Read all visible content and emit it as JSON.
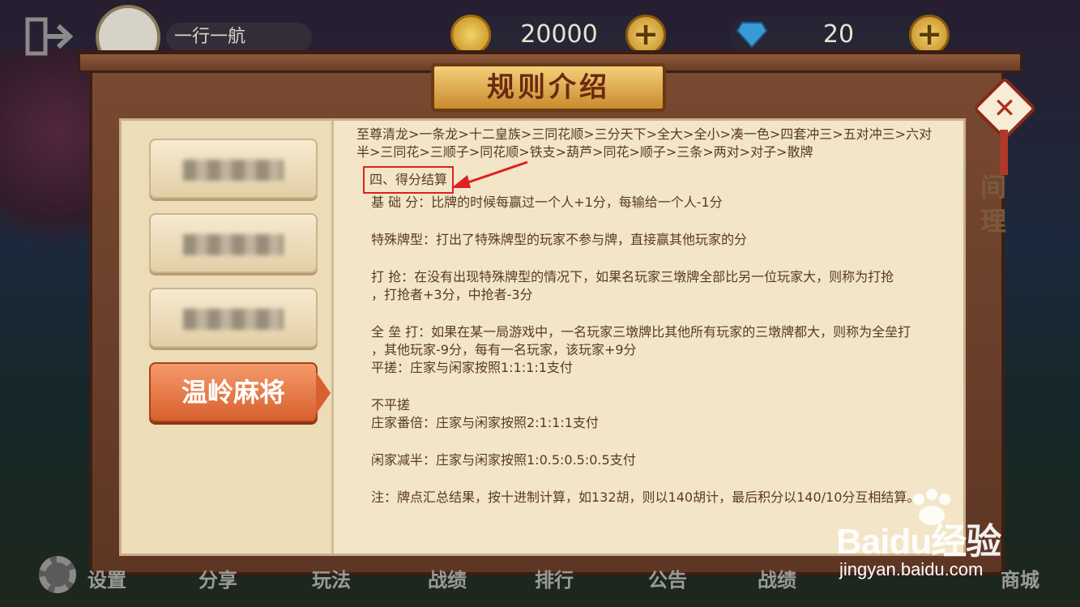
{
  "window": {
    "title": "规则介绍"
  },
  "topbar": {
    "player_name": "一行一航",
    "coins": "20000",
    "gems": "20",
    "coin_plus": "+",
    "gem_plus": "+"
  },
  "sidebar": {
    "items": [
      {
        "label": "",
        "blurred": true
      },
      {
        "label": "",
        "blurred": true
      },
      {
        "label": "",
        "blurred": true
      },
      {
        "label": "温岭麻将",
        "active": true
      }
    ]
  },
  "close": {
    "label": "✕"
  },
  "content": {
    "line1": "至尊清龙>一条龙>十二皇族>三同花顺>三分天下>全大>全小>凑一色>四套冲三>五对冲三>六对",
    "line2": "半>三同花>三顺子>同花顺>铁支>葫芦>同花>顺子>三条>两对>对子>散牌",
    "section": "四、得分结算",
    "base": "基  础  分：比牌的时候每赢过一个人+1分，每输给一个人-1分",
    "special": "特殊牌型：打出了特殊牌型的玩家不参与牌，直接赢其他玩家的分",
    "gun1": "打      抢：在没有出现特殊牌型的情况下，如果名玩家三墩牌全部比另一位玩家大，则称为打抢",
    "gun2": "，打抢者+3分，中抢者-3分",
    "all1": "全  垒  打：如果在某一局游戏中，一名玩家三墩牌比其他所有玩家的三墩牌都大，则称为全垒打",
    "all2": "，其他玩家-9分，每有一名玩家，该玩家+9分",
    "flat": "平搓：庄家与闲家按照1:1:1:1支付",
    "notflat": "不平搓",
    "double": "庄家番倍：庄家与闲家按照2:1:1:1支付",
    "half": "闲家减半：庄家与闲家按照1:0.5:0.5:0.5支付",
    "note": "注：牌点汇总结果，按十进制计算，如132胡，则以140胡计，最后积分以140/10分互相结算。"
  },
  "right_peek": {
    "line1": "间",
    "line2": "理"
  },
  "watermark": {
    "logo": "Baidu经验",
    "url": "jingyan.baidu.com"
  },
  "bottombar": {
    "items": [
      "设置",
      "分享",
      "玩法",
      "战绩",
      "排行",
      "公告",
      "战绩",
      "商城"
    ]
  },
  "colors": {
    "accent": "#d8602e",
    "highlight_box": "#e02020",
    "panel_bg": "#f3e6c8"
  }
}
